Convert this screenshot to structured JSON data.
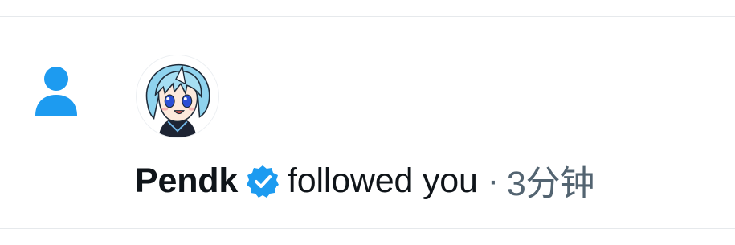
{
  "notification": {
    "username": "Pendk",
    "action": "followed you",
    "separator": "·",
    "time": "3分钟"
  },
  "icons": {
    "type_icon": "person-icon",
    "verified_icon": "verified-badge-icon"
  },
  "colors": {
    "accent": "#1d9bf0",
    "text_primary": "#0f1419",
    "text_secondary": "#536471",
    "divider": "#e6e9ec"
  }
}
